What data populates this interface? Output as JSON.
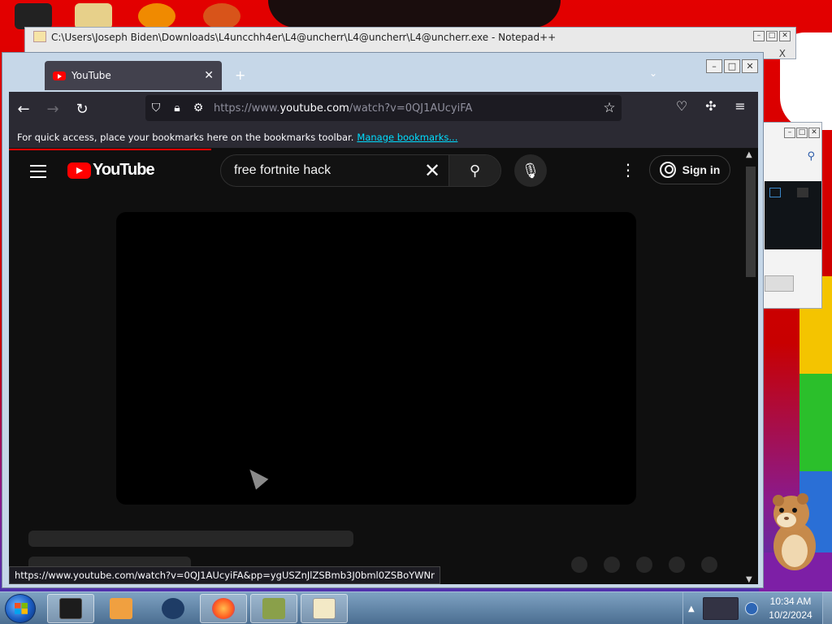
{
  "notepad": {
    "title": "C:\\Users\\Joseph Biden\\Downloads\\L4uncchh4er\\L4@uncherr\\L4@uncherr\\L4@uncherr.exe - Notepad++",
    "close_glyph": "X"
  },
  "browser": {
    "tab_title": "YouTube",
    "tab_close": "✕",
    "new_tab": "+",
    "url_prefix": "https://www.",
    "url_host": "youtube.com",
    "url_path": "/watch?v=0QJ1AUcyiFA",
    "bookmarks_text": "For quick access, place your bookmarks here on the bookmarks toolbar.",
    "bookmarks_link": "Manage bookmarks...",
    "status_url": "https://www.youtube.com/watch?v=0QJ1AUcyiFA&pp=ygUSZnJlZSBmb3J0bml0ZSBoYWNr",
    "page_load_progress": 0.27
  },
  "youtube": {
    "logo_text": "YouTube",
    "search_value": "free fortnite hack",
    "signin_label": "Sign in"
  },
  "taskbar": {
    "time": "10:34 AM",
    "date": "10/2/2024"
  },
  "colors": {
    "youtube_red": "#ff0000",
    "link": "#00ddff",
    "firefox_chrome": "#2b2a33",
    "page_bg": "#0f0f0f"
  }
}
